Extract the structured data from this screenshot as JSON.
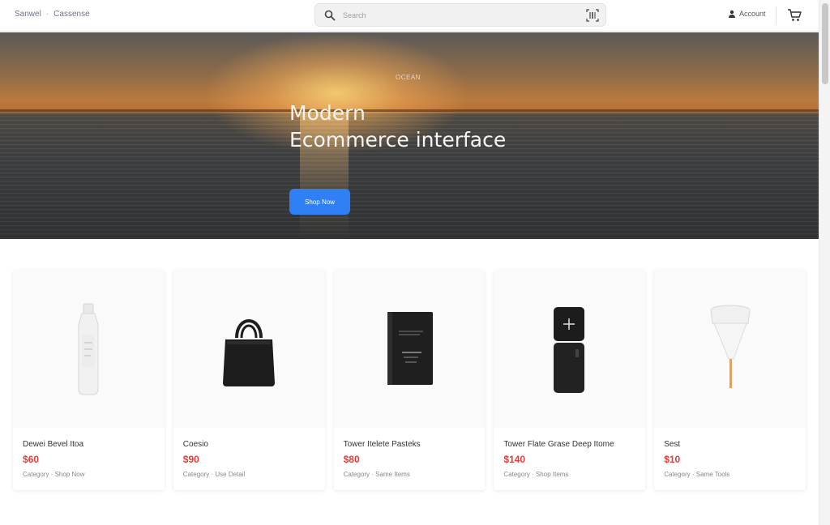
{
  "header": {
    "brand_primary": "Sanwel",
    "brand_separator": "·",
    "brand_secondary": "Cassense",
    "search_placeholder": "Search",
    "account_label": "Account",
    "icons": {
      "search": "search-icon",
      "scan": "barcode-scan-icon",
      "account": "user-icon",
      "cart": "cart-icon"
    }
  },
  "hero": {
    "eyebrow": "OCEAN",
    "title_line1": "Modern",
    "title_line2": "Ecommerce interface",
    "cta_label": "Shop Now"
  },
  "products": [
    {
      "name": "Dewei Bevel Itoa",
      "price": "$60",
      "meta": "Category · Shop Now",
      "image": "bottle"
    },
    {
      "name": "Coesio",
      "price": "$90",
      "meta": "Category · Use Detail",
      "image": "bag"
    },
    {
      "name": "Tower Itelete Pasteks",
      "price": "$80",
      "meta": "Category · Same Items",
      "image": "book"
    },
    {
      "name": "Tower Flate Grase Deep Itome",
      "price": "$140",
      "meta": "Category · Shop Items",
      "image": "device"
    },
    {
      "name": "Sest",
      "price": "$10",
      "meta": "Category · Same Tools",
      "image": "lamp"
    }
  ],
  "colors": {
    "accent": "#2f7ff5",
    "price": "#e23b3b"
  }
}
